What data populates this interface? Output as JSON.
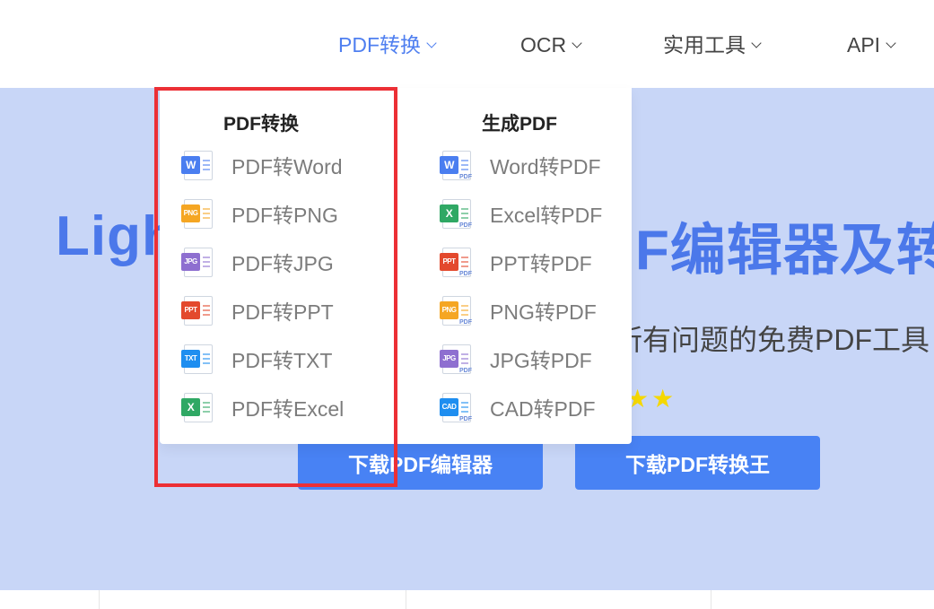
{
  "nav": {
    "items": [
      {
        "label": "PDF转换",
        "active": true
      },
      {
        "label": "OCR",
        "active": false
      },
      {
        "label": "实用工具",
        "active": false
      },
      {
        "label": "API",
        "active": false
      }
    ]
  },
  "hero": {
    "title_left": "Ligh",
    "title_right": "F编辑器及转",
    "subtitle": "所有问题的免费PDF工具",
    "stars": "★★",
    "btn_editor": "下载PDF编辑器",
    "btn_converter": "下载PDF转换王"
  },
  "dropdown": {
    "left": {
      "title": "PDF转换",
      "items": [
        {
          "label": "PDF转Word",
          "icon": "word-icon",
          "badge": "W",
          "color": "#4a7ef0"
        },
        {
          "label": "PDF转PNG",
          "icon": "png-icon",
          "badge": "PNG",
          "color": "#f5a623"
        },
        {
          "label": "PDF转JPG",
          "icon": "jpg-icon",
          "badge": "JPG",
          "color": "#8e6fd0"
        },
        {
          "label": "PDF转PPT",
          "icon": "ppt-icon",
          "badge": "PPT",
          "color": "#e3492d"
        },
        {
          "label": "PDF转TXT",
          "icon": "txt-icon",
          "badge": "TXT",
          "color": "#1e8ef0"
        },
        {
          "label": "PDF转Excel",
          "icon": "excel-icon",
          "badge": "X",
          "color": "#2fa864"
        }
      ]
    },
    "right": {
      "title": "生成PDF",
      "items": [
        {
          "label": "Word转PDF",
          "icon": "word-to-pdf-icon",
          "badge": "W",
          "color": "#4a7ef0"
        },
        {
          "label": "Excel转PDF",
          "icon": "excel-to-pdf-icon",
          "badge": "X",
          "color": "#2fa864"
        },
        {
          "label": "PPT转PDF",
          "icon": "ppt-to-pdf-icon",
          "badge": "PPT",
          "color": "#e3492d"
        },
        {
          "label": "PNG转PDF",
          "icon": "png-to-pdf-icon",
          "badge": "PNG",
          "color": "#f5a623"
        },
        {
          "label": "JPG转PDF",
          "icon": "jpg-to-pdf-icon",
          "badge": "JPG",
          "color": "#8e6fd0"
        },
        {
          "label": "CAD转PDF",
          "icon": "cad-to-pdf-icon",
          "badge": "CAD",
          "color": "#1e8ef0"
        }
      ]
    },
    "pdf_tag": "PDF"
  },
  "colors": {
    "accent": "#4f7ff0",
    "hero_bg": "#c8d6f7",
    "button": "#4882f4",
    "highlight": "#ec2f35"
  }
}
